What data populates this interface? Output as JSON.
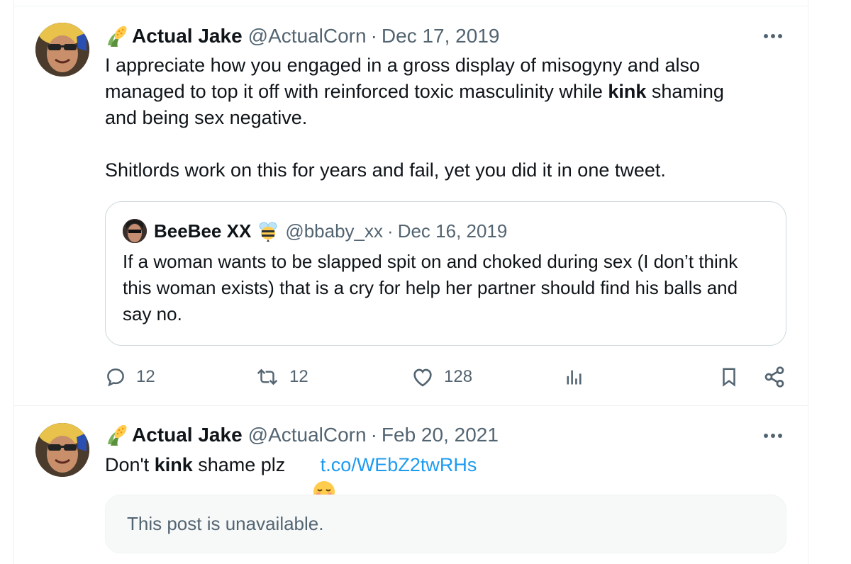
{
  "tweets": [
    {
      "author": {
        "icon": "corn-emoji",
        "display_name": "Actual Jake",
        "handle": "@ActualCorn"
      },
      "separator": "·",
      "date": "Dec 17, 2019",
      "body": {
        "line1": "I appreciate how you engaged in a gross display of misogyny and also",
        "line2_before": "managed to top it off with reinforced toxic masculinity while ",
        "line2_bold": "kink",
        "line2_after": " shaming",
        "line3": "and being sex negative.",
        "line4": "",
        "line5": "Shitlords work on this for years and fail, yet you did it in one tweet."
      },
      "quote": {
        "author": {
          "display_name": "BeeBee XX",
          "icon": "bee-emoji",
          "handle": "@bbaby_xx"
        },
        "separator": "·",
        "date": "Dec 16, 2019",
        "text": "If a woman wants to be slapped spit on and choked during sex (I don’t think this woman exists) that is a cry for help her partner should find his balls and say no."
      },
      "actions": {
        "replies": "12",
        "retweets": "12",
        "likes": "128"
      }
    },
    {
      "author": {
        "icon": "corn-emoji",
        "display_name": "Actual Jake",
        "handle": "@ActualCorn"
      },
      "separator": "·",
      "date": "Feb 20, 2021",
      "body": {
        "before": "Don't ",
        "bold": "kink",
        "after": " shame plz ",
        "emoji": "relieved-face-emoji",
        "link": "t.co/WEbZ2twRHs"
      },
      "unavailable_text": "This post is unavailable."
    }
  ],
  "colors": {
    "text_primary": "#0f1419",
    "text_secondary": "#536471",
    "link": "#1d9bf0",
    "border": "#cfd9de",
    "divider": "#eff3f4",
    "unavailable_bg": "#f7f9f9"
  }
}
